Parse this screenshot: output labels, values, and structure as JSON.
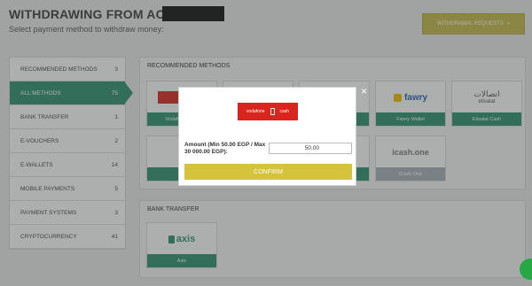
{
  "header": {
    "title": "WITHDRAWING FROM ACCOUNT",
    "subtitle": "Select payment method to withdraw money:",
    "requests_button": "WITHDRAWAL REQUESTS"
  },
  "sidebar": {
    "items": [
      {
        "label": "RECOMMENDED METHODS",
        "count": "3"
      },
      {
        "label": "ALL METHODS",
        "count": "75"
      },
      {
        "label": "BANK TRANSFER",
        "count": "1"
      },
      {
        "label": "E-VOUCHERS",
        "count": "2"
      },
      {
        "label": "E-WALLETS",
        "count": "14"
      },
      {
        "label": "MOBILE PAYMENTS",
        "count": "5"
      },
      {
        "label": "PAYMENT SYSTEMS",
        "count": "3"
      },
      {
        "label": "CRYPTOCURRENCY",
        "count": "41"
      }
    ]
  },
  "recommended": {
    "title": "RECOMMENDED METHODS",
    "cards": [
      {
        "label": "Vodafone Cash"
      },
      {
        "label": ""
      },
      {
        "label": ""
      },
      {
        "label": "Fawry Wallet",
        "logo": "fawry"
      },
      {
        "label": "Etisalat Cash",
        "logo": "اتصالات",
        "logo_sub": "etisalat"
      },
      {
        "label": "Pl"
      },
      {
        "label": ""
      },
      {
        "label": ""
      },
      {
        "label": "iCash One",
        "logo": "icash.one"
      }
    ]
  },
  "bank_transfer": {
    "title": "BANK TRANSFER",
    "cards": [
      {
        "label": "Axis",
        "logo": "axis"
      }
    ]
  },
  "modal": {
    "logo_left": "vodafone",
    "logo_right": "cash",
    "amount_label": "Amount (Min 50.00 EGP / Max 30 000.00 EGP):",
    "amount_value": "50.00",
    "confirm_label": "CONFIRM",
    "close": "×"
  },
  "colors": {
    "accent_green": "#2e8f6e",
    "accent_yellow": "#d4c33b",
    "vodafone_red": "#d8261e"
  }
}
